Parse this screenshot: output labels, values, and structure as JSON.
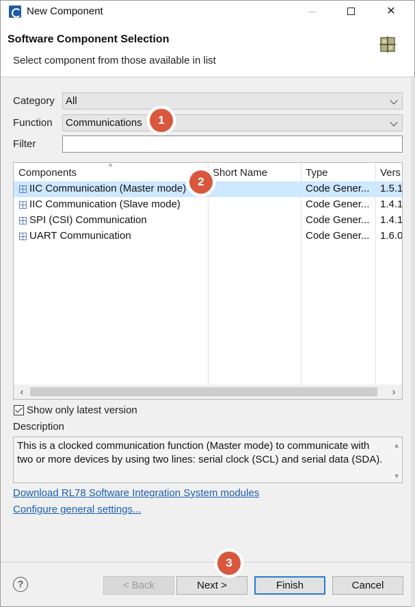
{
  "window": {
    "title": "New Component"
  },
  "header": {
    "title": "Software Component Selection",
    "subtitle": "Select component from those available in list",
    "icon": "component-grid-icon"
  },
  "form": {
    "category_label": "Category",
    "category_value": "All",
    "function_label": "Function",
    "function_value": "Communications",
    "filter_label": "Filter",
    "filter_value": ""
  },
  "table": {
    "columns": [
      "Components",
      "Short Name",
      "Type",
      "Vers"
    ],
    "rows": [
      {
        "name": "IIC Communication (Master mode)",
        "short": "",
        "type": "Code Gener...",
        "version": "1.5.1",
        "selected": true
      },
      {
        "name": "IIC Communication (Slave mode)",
        "short": "",
        "type": "Code Gener...",
        "version": "1.4.1",
        "selected": false
      },
      {
        "name": "SPI (CSI) Communication",
        "short": "",
        "type": "Code Gener...",
        "version": "1.4.1",
        "selected": false
      },
      {
        "name": "UART Communication",
        "short": "",
        "type": "Code Gener...",
        "version": "1.6.0",
        "selected": false
      }
    ]
  },
  "options": {
    "latest_label": "Show only latest version",
    "latest_checked": true
  },
  "description": {
    "label": "Description",
    "text": "This is a clocked communication function (Master mode) to communicate with two or more devices by using two lines: serial clock (SCL) and serial data (SDA)."
  },
  "links": {
    "download": "Download RL78 Software Integration System modules",
    "configure": "Configure general settings..."
  },
  "buttons": {
    "back": "< Back",
    "next": "Next >",
    "finish": "Finish",
    "cancel": "Cancel",
    "help": "?"
  },
  "markers": [
    "1",
    "2",
    "3"
  ],
  "colors": {
    "marker": "#d9573c",
    "selection": "#cde8ff",
    "link": "#1a5fb4"
  }
}
